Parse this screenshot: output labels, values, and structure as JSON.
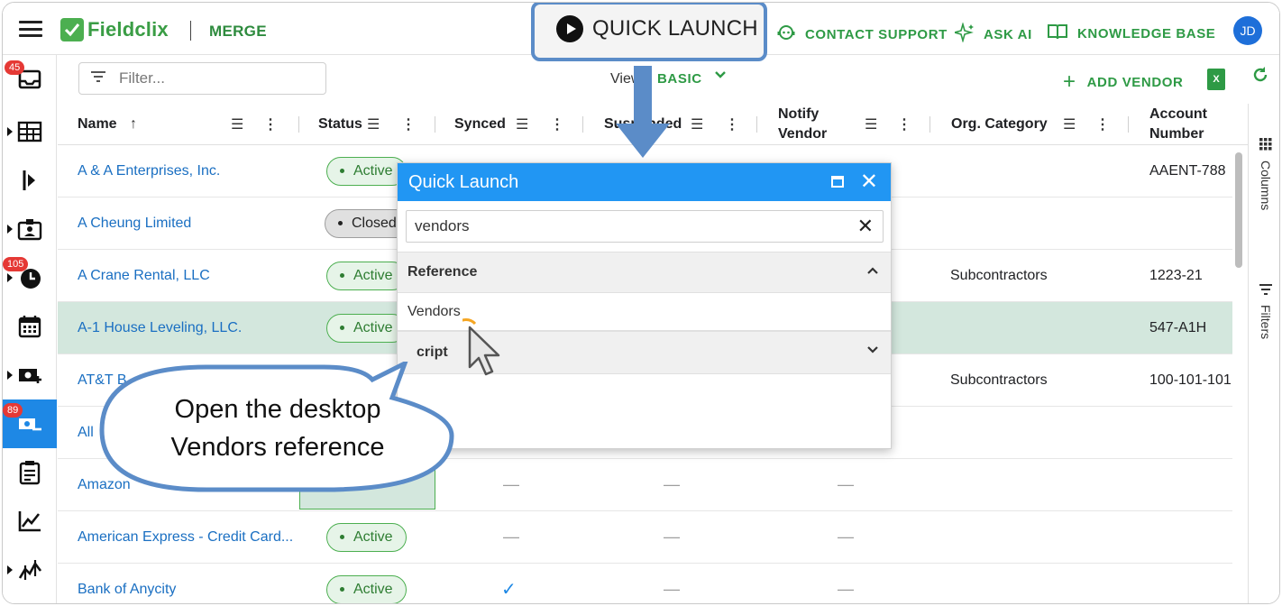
{
  "app": {
    "name": "Fieldclix",
    "module": "MERGE"
  },
  "topbar": {
    "quick_launch": "QUICK LAUNCH",
    "contact_support": "CONTACT SUPPORT",
    "ask_ai": "ASK AI",
    "knowledge_base": "KNOWLEDGE BASE",
    "avatar_initials": "JD"
  },
  "sidebar": {
    "badges": {
      "inbox": "45",
      "time": "105",
      "vendors": "89"
    }
  },
  "toolbar": {
    "filter_placeholder": "Filter...",
    "view_label": "View",
    "view_value": "BASIC",
    "add_vendor": "ADD VENDOR"
  },
  "columns": [
    "Name",
    "Status",
    "Synced",
    "Suspended",
    "Notify Vendor",
    "Org. Category",
    "Account Number"
  ],
  "rows": [
    {
      "name": "A & A Enterprises, Inc.",
      "status": "Active",
      "category": "",
      "account": "AAENT-788"
    },
    {
      "name": "A Cheung Limited",
      "status": "Closed",
      "category": "",
      "account": ""
    },
    {
      "name": "A Crane Rental, LLC",
      "status": "Active",
      "category": "Subcontractors",
      "account": "1223-21"
    },
    {
      "name": "A-1 House Leveling, LLC.",
      "status": "Active",
      "category": "",
      "account": "547-A1H"
    },
    {
      "name": "AT&T B",
      "status": "",
      "category": "Subcontractors",
      "account": "100-101-101"
    },
    {
      "name": "All",
      "status": "",
      "category": "",
      "account": ""
    },
    {
      "name": "Amazon",
      "status": "",
      "synced": "—",
      "suspended": "—",
      "notify": "—",
      "category": "",
      "account": ""
    },
    {
      "name": "American Express - Credit Card...",
      "status": "Active",
      "synced": "—",
      "suspended": "—",
      "notify": "—",
      "category": "",
      "account": ""
    },
    {
      "name": "Bank of Anycity",
      "status": "Active",
      "synced": "✓",
      "suspended": "—",
      "notify": "—",
      "category": "",
      "account": ""
    }
  ],
  "right_rail": {
    "columns": "Columns",
    "filters": "Filters"
  },
  "quick_launch_dialog": {
    "title": "Quick Launch",
    "search_value": "vendors",
    "section_reference": "Reference",
    "item_vendors": "Vendors",
    "section_script": "cript"
  },
  "callout": {
    "line1": "Open the desktop",
    "line2": "Vendors reference"
  },
  "colors": {
    "brand_green": "#2e9a45",
    "accent_blue": "#2196f3",
    "highlight_blue": "#5b8cc8",
    "selected_row": "#d3e7dd"
  }
}
